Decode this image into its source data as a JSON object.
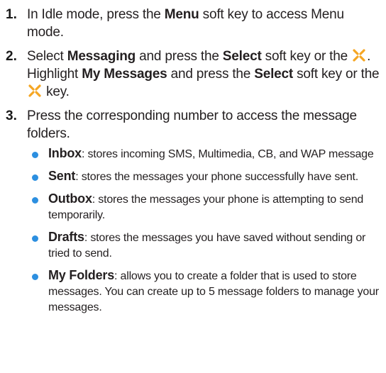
{
  "steps": [
    {
      "number": "1.",
      "t0": "In Idle mode, press the ",
      "b0": "Menu",
      "t1": " soft key to access Menu mode."
    },
    {
      "number": "2.",
      "t0": "Select ",
      "b0": "Messaging",
      "t1": " and press the ",
      "b1": "Select",
      "t2": " soft key or the ",
      "t3": ". Highlight ",
      "b2": "My Messages",
      "t4": " and press the ",
      "b3": "Select",
      "t5": " soft key or the ",
      "t6": " key."
    },
    {
      "number": "3.",
      "t0": "Press the corresponding number to access the message folders."
    }
  ],
  "bullets": [
    {
      "term": "Inbox",
      "desc": ": stores incoming SMS, Multimedia, CB, and WAP message"
    },
    {
      "term": "Sent",
      "desc": ": stores the messages your phone successfully have sent."
    },
    {
      "term": "Outbox",
      "desc": ": stores the messages your phone is attempting to send temporarily."
    },
    {
      "term": "Drafts",
      "desc": ": stores the messages you have saved without sending or tried to send."
    },
    {
      "term": "My Folders",
      "desc": ": allows you to create a folder that is used to store messages. You can create up to 5 message folders to manage your messages."
    }
  ],
  "icons": {
    "nav_key": "navigation-key-icon"
  },
  "colors": {
    "bullet": "#2c8fe0",
    "nav_key": "#f5a623"
  }
}
